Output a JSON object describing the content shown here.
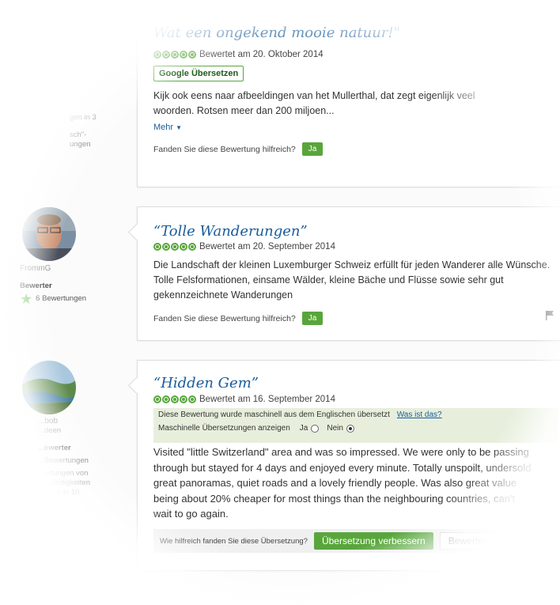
{
  "review1": {
    "title": "Wat een ongekend mooie natuur!\"",
    "rating_text": "Bewertet am 20. Oktober 2014",
    "translate_button": "Google Übersetzen",
    "body": "Kijk ook eens naar afbeeldingen van het Mullerthal, dat zegt eigenlijk veel woorden. Rotsen meer dan 200 miljoen...",
    "more_label": "Mehr",
    "helpful_label": "Fanden Sie diese Bewertung hilfreich?",
    "ja_label": "Ja",
    "sidebar_fragments": [
      "gen in 3",
      "sch\"-",
      "ungen"
    ]
  },
  "review2": {
    "title": "“Tolle Wanderungen”",
    "rating_text": "Bewertet am 20. September 2014",
    "body": "Die Landschaft der kleinen Luxemburger Schweiz erfüllt für jeden Wanderer alle Wünsche. Tolle Felsformationen, einsame Wälder, kleine Bäche und Flüsse sowie sehr gut gekennzeichnete Wanderungen",
    "helpful_label": "Fanden Sie diese Bewertung hilfreich?",
    "ja_label": "Ja",
    "reviewer": {
      "name": "FrommG",
      "level": "Bewerter",
      "review_count": "6 Bewertungen"
    }
  },
  "review3": {
    "title": "“Hidden Gem”",
    "rating_text": "Bewertet am 16. September 2014",
    "notice": "Diese Bewertung wurde maschinell aus dem Englischen übersetzt",
    "notice_link": "Was ist das?",
    "show_machine_label": "Maschinelle Übersetzungen anzeigen",
    "radio_yes": "Ja",
    "radio_no": "Nein",
    "radio_selected": "Nein",
    "body": "Visited \"little Switzerland\" area and was so impressed. We were only to be passing through but stayed for 4 days and enjoyed every minute. Totally unspoilt, undersold great panoramas, quiet roads and a lovely friendly people. Was also great value being about 20% cheaper for most things than the neighbouring countries, can't wait to go again.",
    "translation_helpful_label": "Wie hilfreich fanden Sie diese Übersetzung?",
    "improve_button": "Übersetzung verbessern",
    "rate_button": "Bewerten",
    "reviewer": {
      "name": "...bob",
      "location": "...deen",
      "level": "...ewerter",
      "review_count": "...Bewertungen",
      "extra": [
        "...ertungen von",
        "...swürdigkeiten",
        "...ngen in 10"
      ]
    }
  },
  "colors": {
    "accent_green": "#58a63b",
    "link_blue": "#1a5c9a",
    "notice_bg": "#e7efdc"
  },
  "icons": [
    "rating-bubbles",
    "chevron-down-icon",
    "star-icon",
    "flag-icon"
  ]
}
